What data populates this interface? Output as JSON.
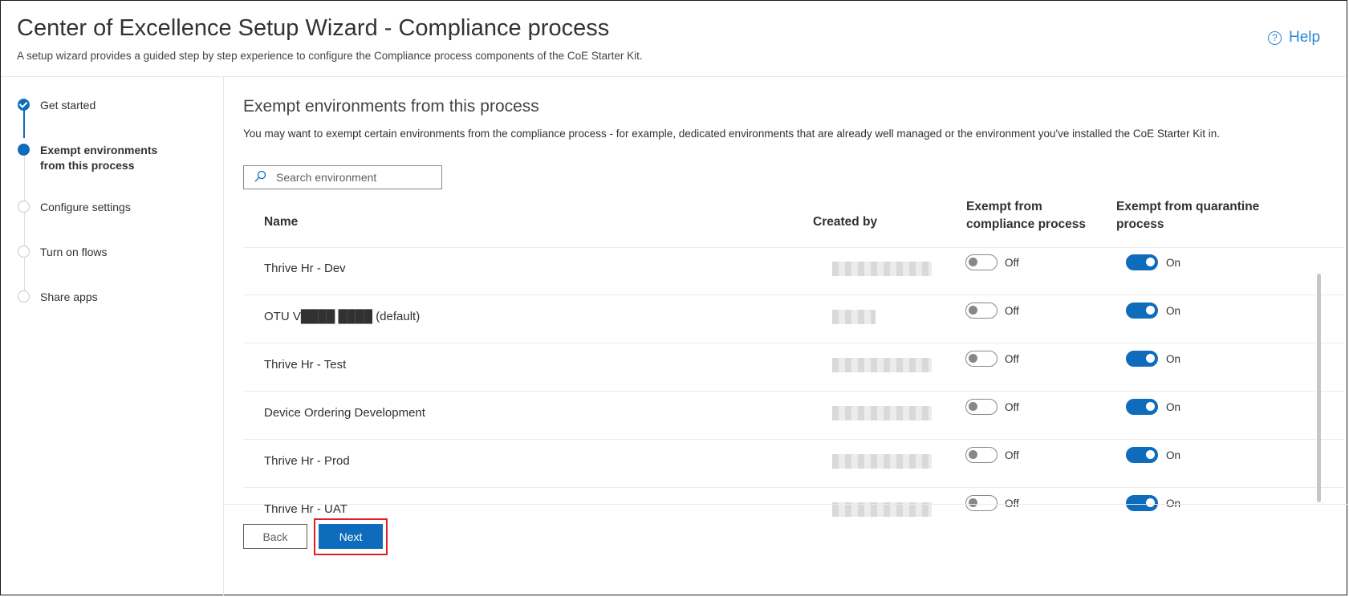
{
  "header": {
    "title": "Center of Excellence Setup Wizard - Compliance process",
    "subtitle": "A setup wizard provides a guided step by step experience to configure the Compliance process components of the CoE Starter Kit.",
    "help_label": "Help"
  },
  "steps": [
    {
      "label": "Get started",
      "state": "done"
    },
    {
      "label": "Exempt environments from this process",
      "state": "current"
    },
    {
      "label": "Configure settings",
      "state": "todo"
    },
    {
      "label": "Turn on flows",
      "state": "todo"
    },
    {
      "label": "Share apps",
      "state": "todo"
    }
  ],
  "section": {
    "title": "Exempt environments from this process",
    "description": "You may want to exempt certain environments from the compliance process - for example, dedicated environments that are already well managed or the environment you've installed the CoE Starter Kit in."
  },
  "search": {
    "placeholder": "Search environment"
  },
  "table": {
    "columns": {
      "name": "Name",
      "created_by": "Created by",
      "exempt_compliance": "Exempt from compliance process",
      "exempt_quarantine": "Exempt from quarantine process"
    },
    "rows": [
      {
        "name": "Thrive Hr - Dev",
        "compliance": "Off",
        "quarantine": "On"
      },
      {
        "name": "OTU V████ ████ (default)",
        "compliance": "Off",
        "quarantine": "On"
      },
      {
        "name": "Thrive Hr - Test",
        "compliance": "Off",
        "quarantine": "On"
      },
      {
        "name": "Device Ordering Development",
        "compliance": "Off",
        "quarantine": "On"
      },
      {
        "name": "Thrive Hr - Prod",
        "compliance": "Off",
        "quarantine": "On"
      },
      {
        "name": "Thrive Hr - UAT",
        "compliance": "Off",
        "quarantine": "On"
      }
    ]
  },
  "footer": {
    "back_label": "Back",
    "next_label": "Next"
  },
  "colors": {
    "accent": "#0f6cbd",
    "highlight": "#e02020"
  }
}
